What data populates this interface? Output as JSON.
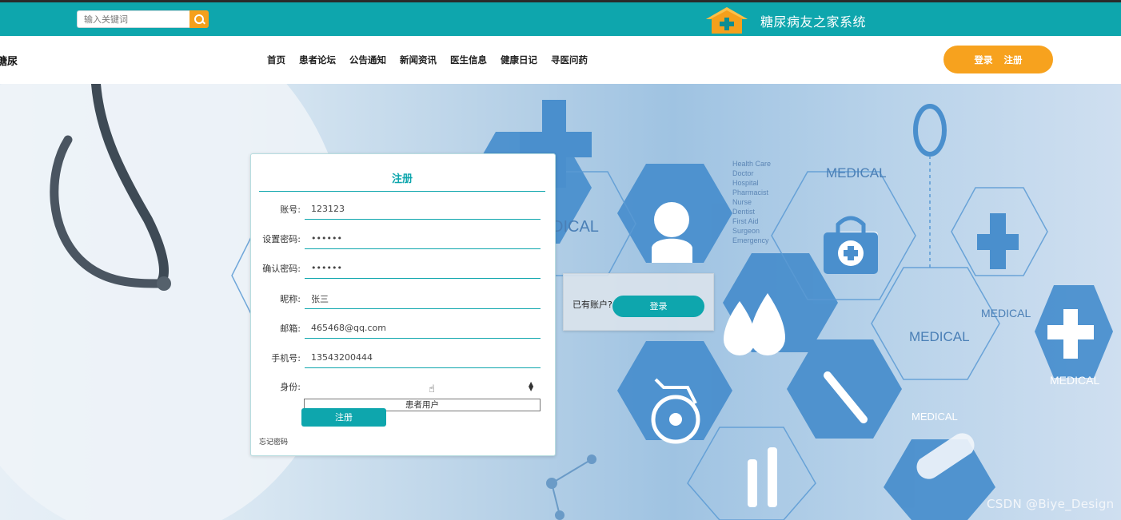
{
  "header": {
    "search_placeholder": "输入关键词",
    "site_title": "糖尿病友之家系统",
    "brand_text": "糖尿"
  },
  "nav": {
    "items": [
      "首页",
      "患者论坛",
      "公告通知",
      "新闻资讯",
      "医生信息",
      "健康日记",
      "寻医问药"
    ],
    "login_label": "登录",
    "register_label": "注册"
  },
  "background_text": {
    "medical_1": "DICAL",
    "medical_2": "MEDICAL",
    "medical_3": "MEDICAL",
    "medical_4": "MEDICAL",
    "medical_5": "MEDICAL",
    "medical_6": "MEDICAL",
    "health_list": [
      "Health Care",
      "Doctor",
      "Hospital",
      "Pharmacist",
      "Nurse",
      "Dentist",
      "First Aid",
      "Surgeon",
      "Emergency"
    ]
  },
  "register_form": {
    "title": "注册",
    "fields": [
      {
        "label": "账号:",
        "value": "123123"
      },
      {
        "label": "设置密码:",
        "value": "••••••"
      },
      {
        "label": "确认密码:",
        "value": "••••••"
      },
      {
        "label": "昵称:",
        "value": "张三"
      },
      {
        "label": "邮箱:",
        "value": "465468@qq.com"
      },
      {
        "label": "手机号:",
        "value": "13543200444"
      }
    ],
    "identity_label": "身份:",
    "identity_option": "患者用户",
    "submit_label": "注册",
    "forgot_label": "忘记密码"
  },
  "login_card": {
    "have_account": "已有账户?",
    "login_label": "登录"
  },
  "watermark": "CSDN @Biye_Design",
  "colors": {
    "teal": "#0ea6ad",
    "orange": "#f7a21e",
    "icon_blue": "#4a8fcd"
  }
}
